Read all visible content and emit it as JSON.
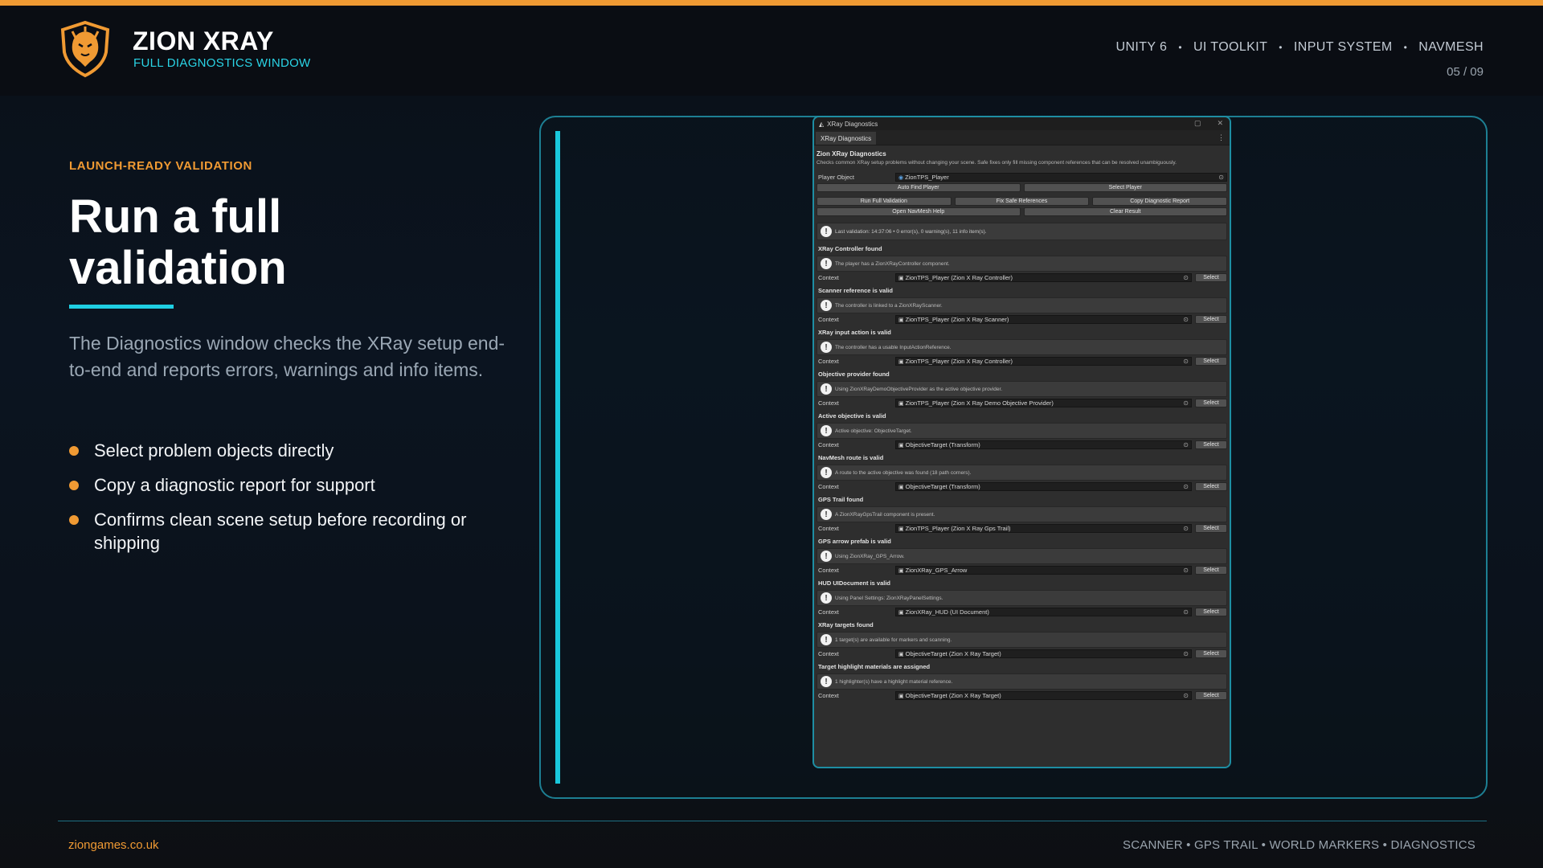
{
  "header": {
    "brand_title": "ZION XRAY",
    "brand_subtitle": "FULL DIAGNOSTICS WINDOW",
    "tech_tags": [
      "UNITY 6",
      "UI TOOLKIT",
      "INPUT SYSTEM",
      "NAVMESH"
    ],
    "separator": "•",
    "page_number": "05 / 09"
  },
  "hero": {
    "kicker": "LAUNCH-READY VALIDATION",
    "headline_line1": "Run a full",
    "headline_line2": "validation",
    "description": "The Diagnostics window checks the XRay setup end-to-end and reports errors, warnings and info items.",
    "bullets": [
      "Select problem objects directly",
      "Copy a diagnostic report for support",
      "Confirms clean scene setup before recording or shipping"
    ]
  },
  "window": {
    "title": "XRay Diagnostics",
    "tab": "XRay Diagnostics",
    "heading": "Zion XRay Diagnostics",
    "subheading": "Checks common XRay setup problems without changing your scene. Safe fixes only fill missing component references that can be resolved unambiguously.",
    "player_label": "Player Object",
    "player_value": "ZionTPS_Player",
    "buttons": {
      "auto_find": "Auto Find Player",
      "select_player": "Select Player",
      "run_full": "Run Full Validation",
      "fix_safe": "Fix Safe References",
      "copy_report": "Copy Diagnostic Report",
      "open_navmesh": "Open NavMesh Help",
      "clear_result": "Clear Result"
    },
    "status": "Last validation: 14:37:06  •  0 error(s), 0 warning(s), 11 info item(s).",
    "context_label": "Context",
    "select_label": "Select",
    "items": [
      {
        "title": "XRay Controller found",
        "message": "The player has a ZionXRayController component.",
        "context": "ZionTPS_Player (Zion X Ray Controller)"
      },
      {
        "title": "Scanner reference is valid",
        "message": "The controller is linked to a ZionXRayScanner.",
        "context": "ZionTPS_Player (Zion X Ray Scanner)"
      },
      {
        "title": "XRay input action is valid",
        "message": "The controller has a usable InputActionReference.",
        "context": "ZionTPS_Player (Zion X Ray Controller)"
      },
      {
        "title": "Objective provider found",
        "message": "Using ZionXRayDemoObjectiveProvider as the active objective provider.",
        "context": "ZionTPS_Player (Zion X Ray Demo Objective Provider)"
      },
      {
        "title": "Active objective is valid",
        "message": "Active objective: ObjectiveTarget.",
        "context": "ObjectiveTarget (Transform)"
      },
      {
        "title": "NavMesh route is valid",
        "message": "A route to the active objective was found (18 path corners).",
        "context": "ObjectiveTarget (Transform)"
      },
      {
        "title": "GPS Trail found",
        "message": "A ZionXRayGpsTrail component is present.",
        "context": "ZionTPS_Player (Zion X Ray Gps Trail)"
      },
      {
        "title": "GPS arrow prefab is valid",
        "message": "Using ZionXRay_GPS_Arrow.",
        "context": "ZionXRay_GPS_Arrow"
      },
      {
        "title": "HUD UIDocument is valid",
        "message": "Using Panel Settings: ZionXRayPanelSettings.",
        "context": "ZionXRay_HUD (UI Document)"
      },
      {
        "title": "XRay targets found",
        "message": "1 target(s) are available for markers and scanning.",
        "context": "ObjectiveTarget (Zion X Ray Target)"
      },
      {
        "title": "Target highlight materials are assigned",
        "message": "1 highlighter(s) have a highlight material reference.",
        "context": "ObjectiveTarget (Zion X Ray Target)"
      }
    ]
  },
  "footer": {
    "website": "ziongames.co.uk",
    "features": "SCANNER • GPS TRAIL • WORLD MARKERS • DIAGNOSTICS"
  },
  "colors": {
    "accent_orange": "#f09a33",
    "accent_cyan": "#1fcfe3",
    "background": "#0b1420"
  }
}
